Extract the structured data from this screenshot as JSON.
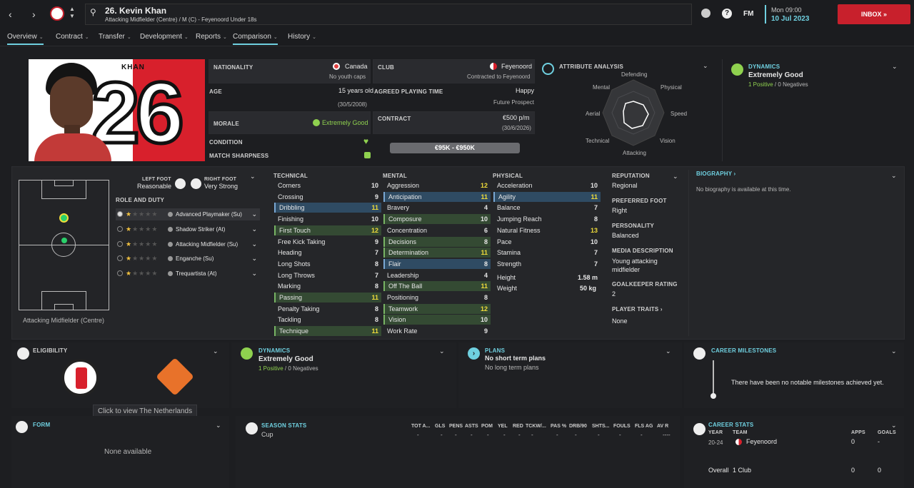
{
  "header": {
    "title": "26. Kevin Khan",
    "subtitle": "Attacking Midfielder (Centre) / M (C) - Feyenoord Under 18s",
    "fm": "FM",
    "time": "Mon 09:00",
    "date": "10 Jul 2023",
    "inbox": "INBOX"
  },
  "tabs": [
    "Overview",
    "Contract",
    "Transfer",
    "Development",
    "Reports",
    "Comparison",
    "History"
  ],
  "hero": {
    "name": "KHAN",
    "number": "26"
  },
  "info": {
    "nationality_lbl": "NATIONALITY",
    "nationality": "Canada",
    "youth_caps": "No youth caps",
    "club_lbl": "CLUB",
    "club": "Feyenoord",
    "club_sub": "Contracted to Feyenoord",
    "age_lbl": "AGE",
    "age": "15 years old",
    "dob": "(30/5/2008)",
    "apt_lbl": "AGREED PLAYING TIME",
    "apt": "Happy",
    "apt_sub": "Future Prospect",
    "morale_lbl": "MORALE",
    "morale": "Extremely Good",
    "contract_lbl": "CONTRACT",
    "wage": "€500 p/m",
    "expiry": "(30/6/2026)",
    "condition_lbl": "CONDITION",
    "sharpness_lbl": "MATCH SHARPNESS",
    "value": "€95K - €950K"
  },
  "analysis": {
    "title": "ATTRIBUTE ANALYSIS",
    "labels": [
      "Defending",
      "Physical",
      "Speed",
      "Vision",
      "Attacking",
      "Technical",
      "Aerial",
      "Mental"
    ]
  },
  "dynamics": {
    "title": "DYNAMICS",
    "value": "Extremely Good",
    "positives": "1 Positive",
    "sep": "/",
    "negatives": "0 Negatives"
  },
  "pitch": {
    "position": "Attacking Midfielder (Centre)"
  },
  "feet": {
    "left_lbl": "LEFT FOOT",
    "left": "Reasonable",
    "right_lbl": "RIGHT FOOT",
    "right": "Very Strong"
  },
  "roles_title": "ROLE AND DUTY",
  "roles": [
    {
      "name": "Advanced Playmaker (Su)",
      "stars": 1
    },
    {
      "name": "Shadow Striker (At)",
      "stars": 1
    },
    {
      "name": "Attacking Midfielder (Su)",
      "stars": 1
    },
    {
      "name": "Enganche (Su)",
      "stars": 0.5
    },
    {
      "name": "Trequartista (At)",
      "stars": 0.5
    }
  ],
  "technical": {
    "title": "TECHNICAL",
    "rows": [
      [
        "Corners",
        "10",
        ""
      ],
      [
        "Crossing",
        "9",
        ""
      ],
      [
        "Dribbling",
        "11",
        "b"
      ],
      [
        "Finishing",
        "10",
        ""
      ],
      [
        "First Touch",
        "12",
        "g"
      ],
      [
        "Free Kick Taking",
        "9",
        ""
      ],
      [
        "Heading",
        "7",
        ""
      ],
      [
        "Long Shots",
        "8",
        ""
      ],
      [
        "Long Throws",
        "7",
        ""
      ],
      [
        "Marking",
        "8",
        ""
      ],
      [
        "Passing",
        "11",
        "g"
      ],
      [
        "Penalty Taking",
        "8",
        ""
      ],
      [
        "Tackling",
        "8",
        ""
      ],
      [
        "Technique",
        "11",
        "g"
      ]
    ]
  },
  "mental": {
    "title": "MENTAL",
    "rows": [
      [
        "Aggression",
        "12",
        ""
      ],
      [
        "Anticipation",
        "11",
        "b"
      ],
      [
        "Bravery",
        "4",
        ""
      ],
      [
        "Composure",
        "10",
        "g"
      ],
      [
        "Concentration",
        "6",
        ""
      ],
      [
        "Decisions",
        "8",
        "g"
      ],
      [
        "Determination",
        "11",
        "g"
      ],
      [
        "Flair",
        "8",
        "b"
      ],
      [
        "Leadership",
        "4",
        ""
      ],
      [
        "Off The Ball",
        "11",
        "g"
      ],
      [
        "Positioning",
        "8",
        ""
      ],
      [
        "Teamwork",
        "12",
        "g"
      ],
      [
        "Vision",
        "10",
        "g"
      ],
      [
        "Work Rate",
        "9",
        ""
      ]
    ]
  },
  "physical": {
    "title": "PHYSICAL",
    "rows": [
      [
        "Acceleration",
        "10",
        ""
      ],
      [
        "Agility",
        "11",
        "b"
      ],
      [
        "Balance",
        "7",
        ""
      ],
      [
        "Jumping Reach",
        "8",
        ""
      ],
      [
        "Natural Fitness",
        "13",
        ""
      ],
      [
        "Pace",
        "10",
        ""
      ],
      [
        "Stamina",
        "7",
        ""
      ],
      [
        "Strength",
        "7",
        ""
      ]
    ],
    "height_lbl": "Height",
    "height": "1.58 m",
    "weight_lbl": "Weight",
    "weight": "50 kg"
  },
  "profile": {
    "rep_lbl": "REPUTATION",
    "rep": "Regional",
    "foot_lbl": "PREFERRED FOOT",
    "foot": "Right",
    "pers_lbl": "PERSONALITY",
    "pers": "Balanced",
    "media_lbl": "MEDIA DESCRIPTION",
    "media": "Young attacking midfielder",
    "gk_lbl": "GOALKEEPER RATING",
    "gk": "2",
    "traits_lbl": "PLAYER TRAITS",
    "traits": "None"
  },
  "biography": {
    "title": "BIOGRAPHY",
    "text": "No biography is available at this time."
  },
  "eligibility": {
    "title": "ELIGIBILITY",
    "tooltip": "Click to view The Netherlands"
  },
  "plans": {
    "title": "PLANS",
    "short": "No short term plans",
    "long": "No long term plans"
  },
  "milestones": {
    "title": "CAREER MILESTONES",
    "text": "There have been no notable milestones achieved yet."
  },
  "form": {
    "title": "FORM",
    "text": "None available"
  },
  "season": {
    "title": "SEASON STATS",
    "row": "Cup",
    "headers": [
      "TOT A...",
      "GLS",
      "PENS",
      "ASTS",
      "POM",
      "YEL",
      "RED",
      "TCKW/...",
      "PAS %",
      "DRB/90",
      "SHTS...",
      "FOULS",
      "FLS AG",
      "AV R"
    ],
    "values": [
      "-",
      "-",
      "-",
      "-",
      "-",
      "-",
      "-",
      "-",
      "-",
      "-",
      "-",
      "-",
      "-",
      "----"
    ]
  },
  "career": {
    "title": "CAREER STATS",
    "h_year": "YEAR",
    "h_team": "TEAM",
    "h_apps": "APPS",
    "h_goals": "GOALS",
    "year": "20-24",
    "team": "Feyenoord",
    "apps": "0",
    "goals": "-",
    "overall": "Overall",
    "clubs": "1 Club",
    "o_apps": "0",
    "o_goals": "0"
  },
  "colors": {
    "accent": "#6fd0e0",
    "inbox": "#c8202c",
    "positive": "#8fd14f",
    "highlight": "#f0dc3a"
  }
}
